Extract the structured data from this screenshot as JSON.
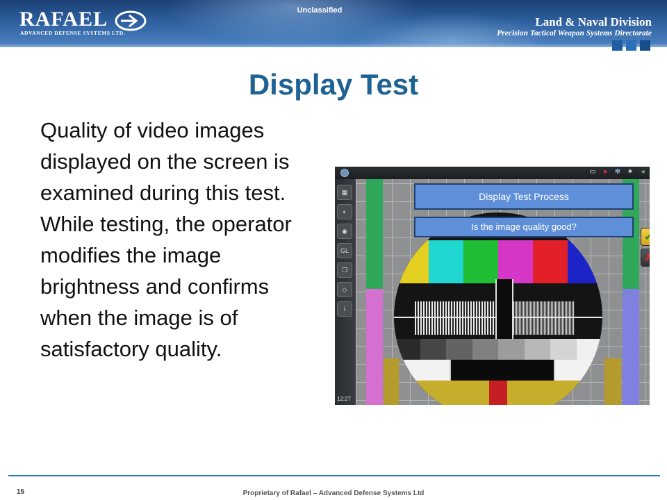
{
  "header": {
    "logo_word": "RAFAEL",
    "logo_sub": "ADVANCED DEFENSE SYSTEMS LTD.",
    "classification": "Unclassified",
    "division": "Land & Naval Division",
    "directorate": "Precision Tactical Weapon Systems Directorate"
  },
  "slide": {
    "title": "Display Test",
    "body": "Quality of video images displayed on the screen is examined during this test. While testing, the operator modifies the image brightness and confirms when the image is of satisfactory quality."
  },
  "screenshot": {
    "dialog_title": "Display Test Process",
    "dialog_question": "Is the image quality good?",
    "confirm_icon": "check-icon",
    "reject_icon": "x-icon",
    "tool_gl_label": "GL",
    "clock": "12:27",
    "color_bars": [
      "#e3cf1f",
      "#1fd6d0",
      "#1fbe35",
      "#d637c7",
      "#e3202a",
      "#1c24c8"
    ],
    "grey_steps": [
      "#2a2a2a",
      "#464646",
      "#636363",
      "#808080",
      "#9c9c9c",
      "#b8b8b8",
      "#d4d4d4",
      "#efefef"
    ],
    "side_bars": {
      "left_green": "#2fa85a",
      "left_pink": "#d470d0",
      "right_green": "#2fa85a",
      "right_blue": "#7f80e0",
      "olive": "#b59a2e"
    }
  },
  "footer": {
    "slide_number": "15",
    "text": "Proprietary of Rafael – Advanced Defense Systems Ltd"
  }
}
